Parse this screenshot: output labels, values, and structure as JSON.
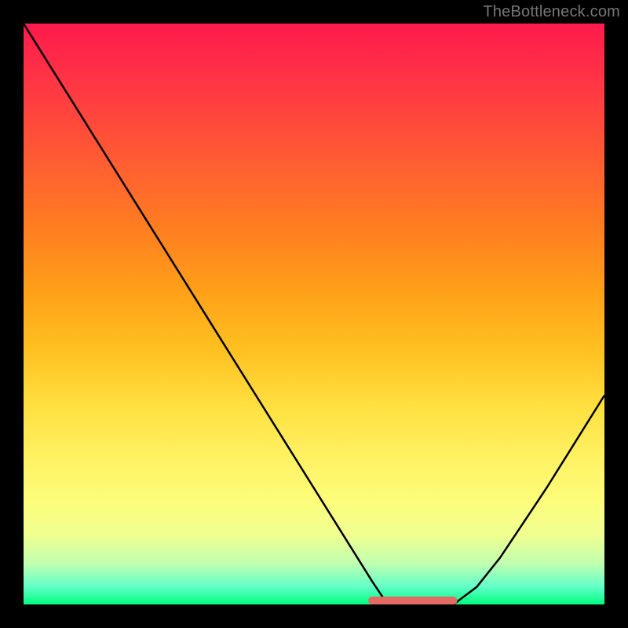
{
  "watermark": "TheBottleneck.com",
  "colors": {
    "frame": "#000000",
    "curve": "#000000",
    "baseline_accent": "#e26a63",
    "gradient_top": "#ff1a4d",
    "gradient_bottom": "#00ff7f"
  },
  "chart_data": {
    "type": "line",
    "title": "",
    "xlabel": "",
    "ylabel": "",
    "xlim": [
      0,
      100
    ],
    "ylim": [
      0,
      100
    ],
    "grid": false,
    "legend": false,
    "x": [
      0,
      5,
      10,
      15,
      20,
      25,
      30,
      35,
      40,
      45,
      50,
      55,
      60,
      62,
      65,
      68,
      70,
      72,
      74,
      78,
      82,
      86,
      90,
      95,
      100
    ],
    "values": [
      100,
      92,
      84,
      76,
      68,
      60,
      52,
      44,
      36,
      28,
      20,
      12,
      4,
      1,
      0,
      0,
      0,
      0,
      0,
      3,
      8,
      14,
      20,
      28,
      36
    ],
    "baseline_flat": {
      "x_range": [
        60,
        74
      ],
      "y": 0
    }
  }
}
